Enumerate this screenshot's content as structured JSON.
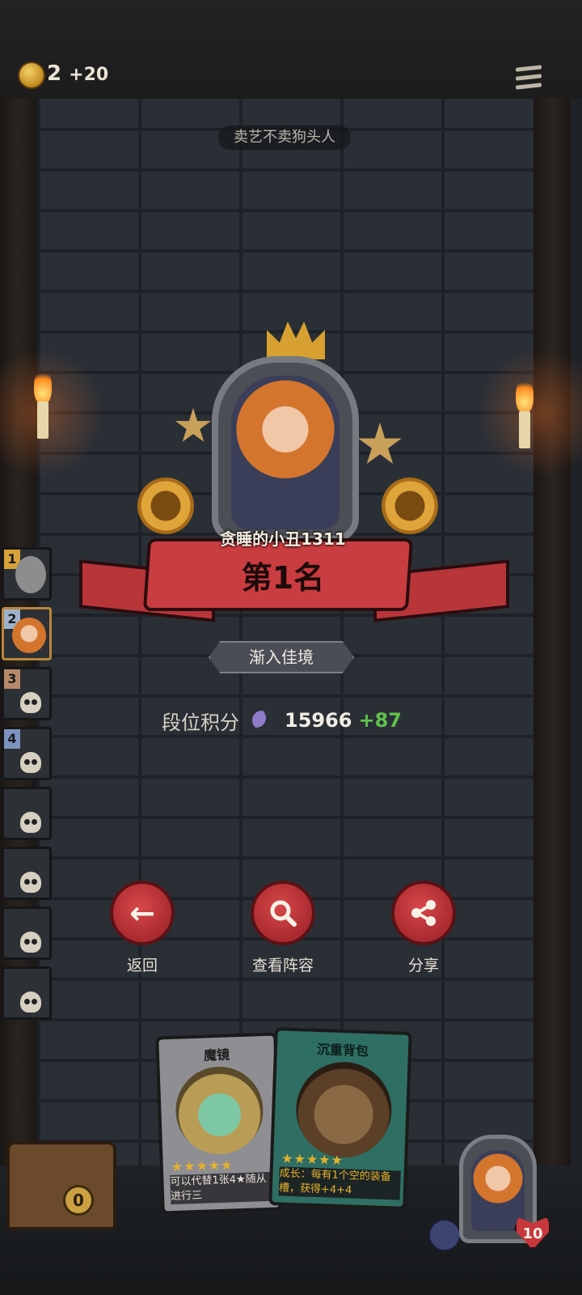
{
  "header": {
    "coins": "2",
    "coins_delta": "+20"
  },
  "top_label": "卖艺不卖狗头人",
  "result": {
    "player_name": "贪睡的小丑1311",
    "rank_text": "第1名",
    "title_badge": "渐入佳境"
  },
  "score": {
    "label": "段位积分",
    "value": "15966",
    "delta": "+87"
  },
  "actions": [
    {
      "label": "返回",
      "icon": "arrow-left-icon"
    },
    {
      "label": "查看阵容",
      "icon": "search-icon"
    },
    {
      "label": "分享",
      "icon": "share-icon"
    }
  ],
  "ranking_sidebar": [
    {
      "slot": "1"
    },
    {
      "slot": "2"
    },
    {
      "slot": "3"
    },
    {
      "slot": "4"
    },
    {
      "slot": ""
    },
    {
      "slot": ""
    },
    {
      "slot": ""
    },
    {
      "slot": ""
    }
  ],
  "cards": [
    {
      "title": "魔镜",
      "text": "可以代替1张4★随从进行三",
      "stars": "★★★★★"
    },
    {
      "title": "沉重背包",
      "text": "成长：每有1个空的装备槽，获得+4+4",
      "stars": "★★★★★"
    }
  ],
  "bottom": {
    "bucket_count": "0",
    "hero_health": "10"
  },
  "colors": {
    "ribbon": "#c93c40",
    "button": "#c0353a",
    "score_delta": "#5ec24a"
  }
}
